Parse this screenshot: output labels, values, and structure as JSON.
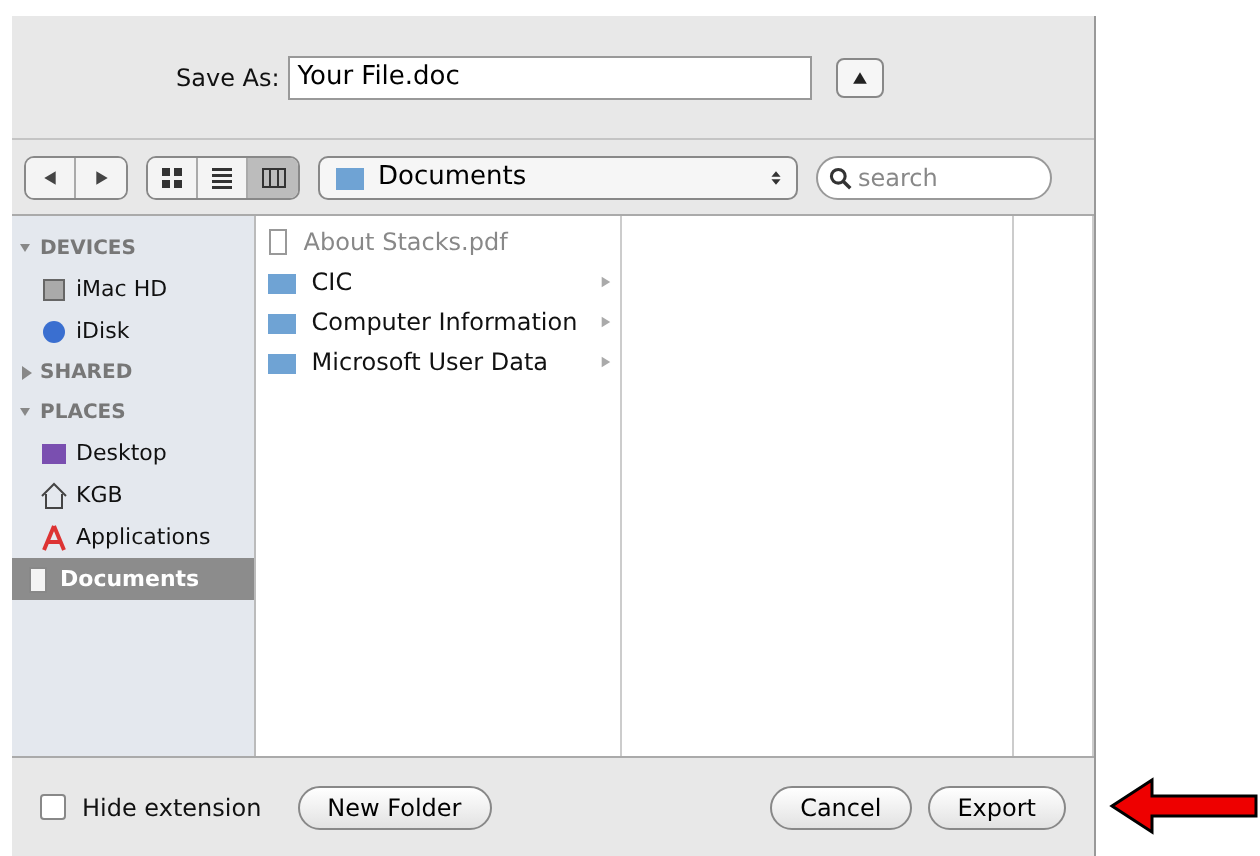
{
  "save_as": {
    "label": "Save As:",
    "value": "Your File.doc"
  },
  "toolbar": {
    "views": [
      {
        "kind": "icons",
        "selected": false
      },
      {
        "kind": "list",
        "selected": false
      },
      {
        "kind": "columns",
        "selected": true
      }
    ],
    "location": "Documents",
    "search": {
      "placeholder": "search"
    }
  },
  "sidebar": [
    {
      "title": "DEVICES",
      "expanded": true,
      "items": [
        {
          "label": "iMac HD",
          "kind": "drive",
          "selected": false
        },
        {
          "label": "iDisk",
          "kind": "disk",
          "selected": false
        }
      ]
    },
    {
      "title": "SHARED",
      "expanded": false
    },
    {
      "title": "PLACES",
      "expanded": true,
      "items": [
        {
          "label": "Desktop",
          "kind": "desktop",
          "selected": false
        },
        {
          "label": "KGB",
          "kind": "home",
          "selected": false
        },
        {
          "label": "Applications",
          "kind": "apps",
          "selected": false
        },
        {
          "label": "Documents",
          "kind": "docs",
          "selected": true
        }
      ]
    }
  ],
  "files": [
    {
      "name": "About Stacks.pdf",
      "kind": "file",
      "disabled": true
    },
    {
      "name": "CIC",
      "kind": "folder",
      "disabled": false
    },
    {
      "name": "Computer Information",
      "kind": "folder",
      "disabled": false
    },
    {
      "name": "Microsoft User Data",
      "kind": "folder",
      "disabled": false
    }
  ],
  "hide_extension": {
    "label": "Hide extension",
    "checked": false
  },
  "buttons": [
    {
      "label": "New Folder",
      "kind": "left"
    },
    {
      "label": "Cancel",
      "kind": "right"
    },
    {
      "label": "Export",
      "kind": "right"
    }
  ]
}
